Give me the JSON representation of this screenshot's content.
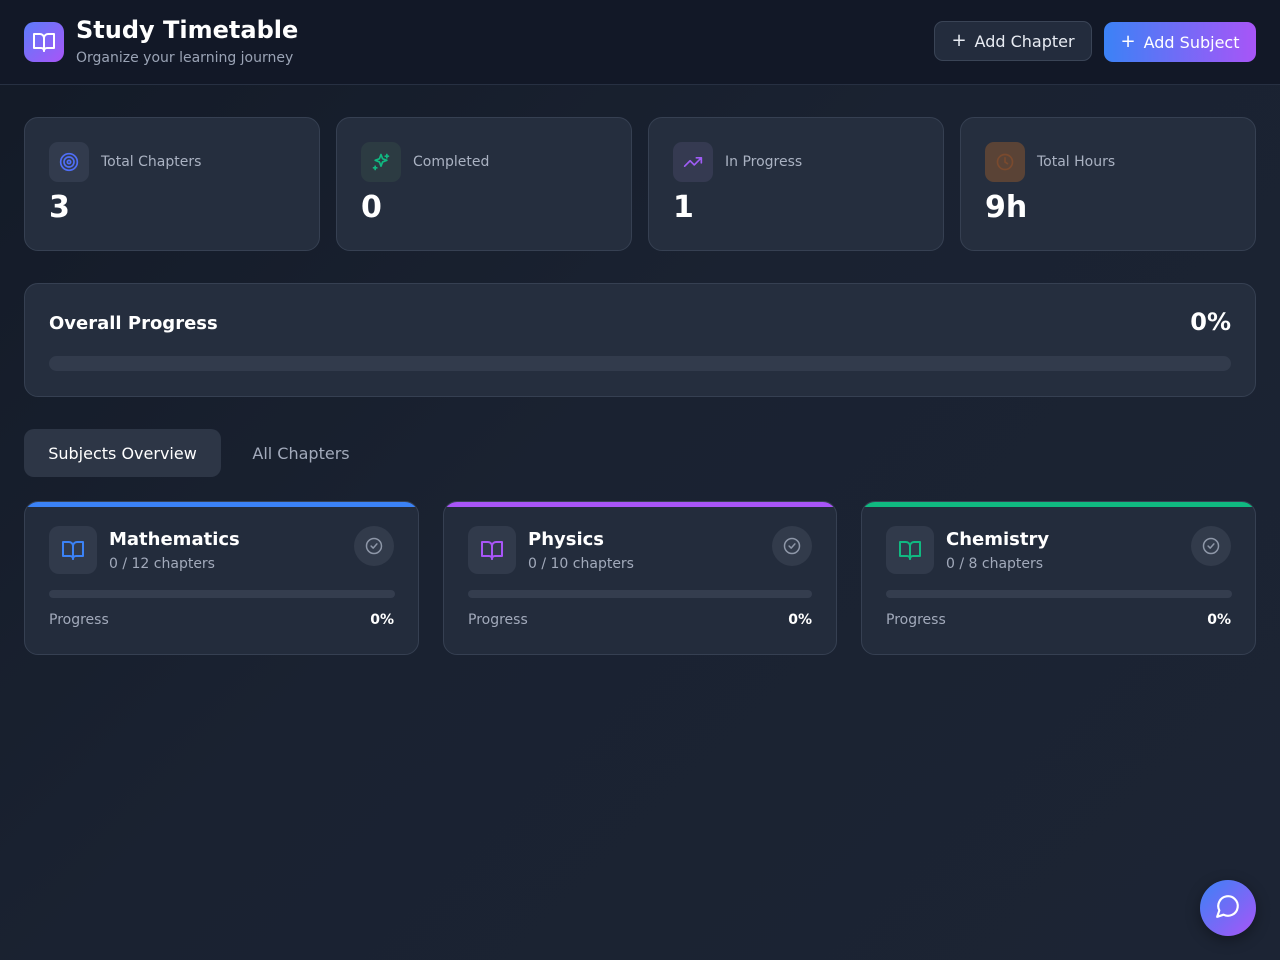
{
  "app": {
    "title": "Study Timetable",
    "subtitle": "Organize your learning journey",
    "logo_icon": "book-open-icon",
    "accent_gradient": [
      "#3b82f6",
      "#a855f7"
    ]
  },
  "header": {
    "add_chapter_label": "Add Chapter",
    "add_subject_label": "Add Subject"
  },
  "stats": [
    {
      "label": "Total Chapters",
      "value": "3",
      "icon": "target-icon",
      "color": "#4f6ef7"
    },
    {
      "label": "Completed",
      "value": "0",
      "icon": "sparkles-icon",
      "color": "#10b981"
    },
    {
      "label": "In Progress",
      "value": "1",
      "icon": "trending-up-icon",
      "color": "#9f5cf5"
    },
    {
      "label": "Total Hours",
      "value": "9h",
      "icon": "clock-icon",
      "color": "#b45f35"
    }
  ],
  "overall_progress": {
    "title": "Overall Progress",
    "percent_label": "0%",
    "percent": 0
  },
  "tabs": [
    {
      "label": "Subjects Overview",
      "active": true
    },
    {
      "label": "All Chapters",
      "active": false
    }
  ],
  "subjects": [
    {
      "name": "Mathematics",
      "count": "0 / 12 chapters",
      "progress_label": "Progress",
      "percent_label": "0%",
      "percent": 0,
      "color": "#3b82f6",
      "icon": "book-open-icon"
    },
    {
      "name": "Physics",
      "count": "0 / 10 chapters",
      "progress_label": "Progress",
      "percent_label": "0%",
      "percent": 0,
      "color": "#a855f7",
      "icon": "book-open-icon"
    },
    {
      "name": "Chemistry",
      "count": "0 / 8 chapters",
      "progress_label": "Progress",
      "percent_label": "0%",
      "percent": 0,
      "color": "#10b981",
      "icon": "book-open-icon"
    }
  ],
  "chat": {
    "icon": "chat-bubble-icon"
  }
}
